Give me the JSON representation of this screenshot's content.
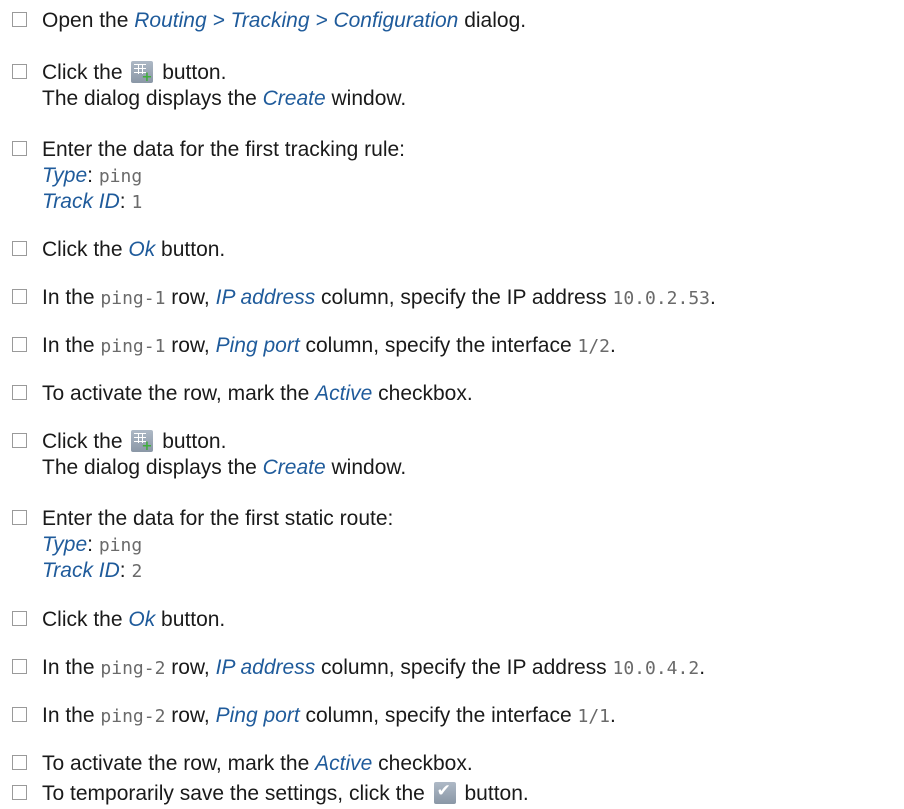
{
  "steps": [
    {
      "lines": [
        [
          {
            "t": "Open the "
          },
          {
            "t": "Routing > Tracking > Configuration",
            "s": "ui"
          },
          {
            "t": " dialog."
          }
        ]
      ]
    },
    {
      "lines": [
        [
          {
            "t": "Click the "
          },
          {
            "icon": "add-table-row-icon"
          },
          {
            "t": " button."
          }
        ],
        [
          {
            "t": "The dialog displays the "
          },
          {
            "t": "Create",
            "s": "ui"
          },
          {
            "t": " window."
          }
        ]
      ]
    },
    {
      "lines": [
        [
          {
            "t": "Enter the data for the first tracking rule:"
          }
        ],
        [
          {
            "t": "Type",
            "s": "ui"
          },
          {
            "t": ":  "
          },
          {
            "t": "ping",
            "s": "mono"
          }
        ],
        [
          {
            "t": "Track ID",
            "s": "ui"
          },
          {
            "t": ":  "
          },
          {
            "t": "1",
            "s": "mono"
          }
        ]
      ]
    },
    {
      "lines": [
        [
          {
            "t": "Click the "
          },
          {
            "t": "Ok",
            "s": "ui"
          },
          {
            "t": " button."
          }
        ]
      ]
    },
    {
      "lines": [
        [
          {
            "t": "In the "
          },
          {
            "t": "ping-1",
            "s": "mono"
          },
          {
            "t": " row, "
          },
          {
            "t": "IP address",
            "s": "ui"
          },
          {
            "t": " column, specify the IP address "
          },
          {
            "t": "10.0.2.53",
            "s": "mono"
          },
          {
            "t": "."
          }
        ]
      ]
    },
    {
      "lines": [
        [
          {
            "t": "In the "
          },
          {
            "t": "ping-1",
            "s": "mono"
          },
          {
            "t": " row, "
          },
          {
            "t": "Ping port",
            "s": "ui"
          },
          {
            "t": " column, specify the interface "
          },
          {
            "t": "1/2",
            "s": "mono"
          },
          {
            "t": "."
          }
        ]
      ]
    },
    {
      "lines": [
        [
          {
            "t": "To activate the row, mark the "
          },
          {
            "t": "Active",
            "s": "ui"
          },
          {
            "t": " checkbox."
          }
        ]
      ]
    },
    {
      "lines": [
        [
          {
            "t": "Click the "
          },
          {
            "icon": "add-table-row-icon"
          },
          {
            "t": " button."
          }
        ],
        [
          {
            "t": "The dialog displays the "
          },
          {
            "t": "Create",
            "s": "ui"
          },
          {
            "t": " window."
          }
        ]
      ]
    },
    {
      "lines": [
        [
          {
            "t": "Enter the data for the first static route:"
          }
        ],
        [
          {
            "t": "Type",
            "s": "ui"
          },
          {
            "t": ":  "
          },
          {
            "t": "ping",
            "s": "mono"
          }
        ],
        [
          {
            "t": "Track ID",
            "s": "ui"
          },
          {
            "t": ":  "
          },
          {
            "t": "2",
            "s": "mono"
          }
        ]
      ]
    },
    {
      "lines": [
        [
          {
            "t": "Click the "
          },
          {
            "t": "Ok",
            "s": "ui"
          },
          {
            "t": " button."
          }
        ]
      ]
    },
    {
      "lines": [
        [
          {
            "t": "In the "
          },
          {
            "t": "ping-2",
            "s": "mono"
          },
          {
            "t": " row, "
          },
          {
            "t": "IP address",
            "s": "ui"
          },
          {
            "t": " column, specify the IP address "
          },
          {
            "t": "10.0.4.2",
            "s": "mono"
          },
          {
            "t": "."
          }
        ]
      ]
    },
    {
      "lines": [
        [
          {
            "t": "In the "
          },
          {
            "t": "ping-2",
            "s": "mono"
          },
          {
            "t": " row, "
          },
          {
            "t": "Ping port",
            "s": "ui"
          },
          {
            "t": " column, specify the interface "
          },
          {
            "t": "1/1",
            "s": "mono"
          },
          {
            "t": "."
          }
        ]
      ]
    },
    {
      "lines": [
        [
          {
            "t": "To activate the row, mark the "
          },
          {
            "t": "Active",
            "s": "ui"
          },
          {
            "t": " checkbox."
          }
        ]
      ]
    },
    {
      "lines": [
        [
          {
            "t": "To temporarily save the settings, click the "
          },
          {
            "icon": "save-checkmark-icon"
          },
          {
            "t": " button."
          }
        ]
      ]
    }
  ]
}
